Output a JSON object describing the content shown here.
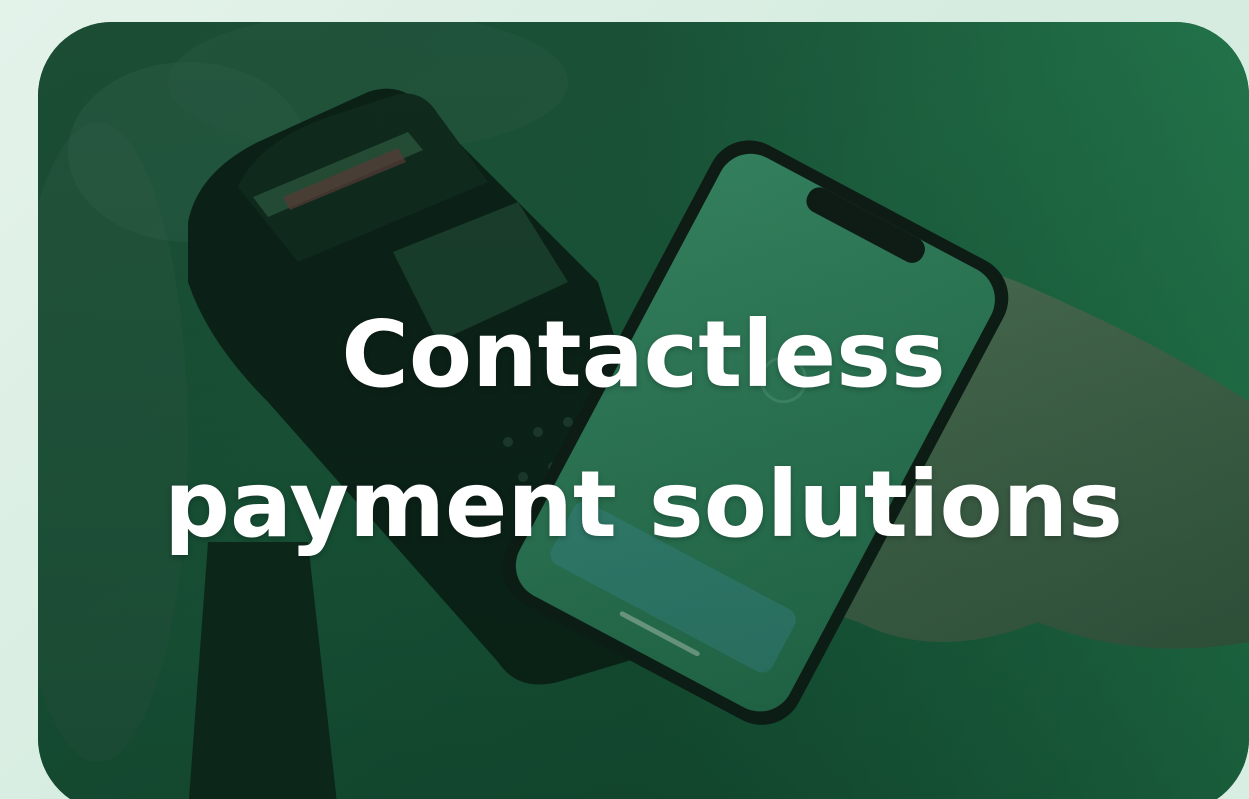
{
  "hero": {
    "title_line1": "Contactless",
    "title_line2": "payment solutions"
  },
  "colors": {
    "background": "#dcefe5",
    "overlay_green": "#1f7a4a",
    "title_text": "#ffffff"
  },
  "icons": {
    "photo": "payment-terminal-phone-photo"
  }
}
